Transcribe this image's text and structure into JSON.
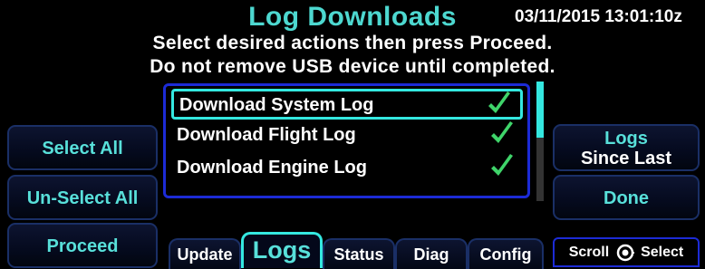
{
  "header": {
    "title": "Log Downloads",
    "datetime": "03/11/2015 13:01:10z",
    "instruction_1": "Select desired actions then press Proceed.",
    "instruction_2": "Do not remove USB device until completed."
  },
  "log_list": {
    "items": [
      {
        "label": "Download System Log",
        "checked": true,
        "selected": true
      },
      {
        "label": "Download Flight Log",
        "checked": true,
        "selected": false
      },
      {
        "label": "Download Engine Log",
        "checked": true,
        "selected": false
      }
    ],
    "check_color": "#3fd46a"
  },
  "left_buttons": {
    "select_all": "Select All",
    "unselect_all": "Un-Select All",
    "proceed": "Proceed"
  },
  "right_buttons": {
    "logs_line1": "Logs",
    "logs_line2": "Since Last",
    "done": "Done"
  },
  "tabs": [
    {
      "label": "Update",
      "active": false
    },
    {
      "label": "Logs",
      "active": true
    },
    {
      "label": "Status",
      "active": false
    },
    {
      "label": "Diag",
      "active": false
    },
    {
      "label": "Config",
      "active": false
    }
  ],
  "hint": {
    "scroll": "Scroll",
    "select": "Select",
    "icon": "knob-icon"
  },
  "colors": {
    "accent": "#34e8e0",
    "panel_border": "#1c2bd6",
    "text_cyan": "#58e0da"
  }
}
